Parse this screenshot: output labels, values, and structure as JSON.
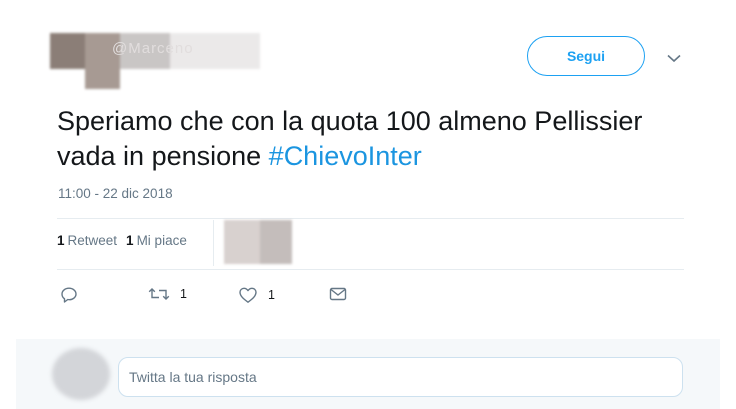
{
  "header": {
    "author_name_blurred": "@Marceno",
    "follow_label": "Segui"
  },
  "tweet": {
    "text_plain": "Speriamo che con la quota 100 almeno Pellissier vada in pensione ",
    "hashtag": "#ChievoInter",
    "timestamp": "11:00 - 22 dic 2018"
  },
  "stats": {
    "retweets_count": "1",
    "retweets_label": "Retweet",
    "likes_count": "1",
    "likes_label": "Mi piace"
  },
  "actions": {
    "reply_icon": "reply-icon",
    "retweet_icon": "retweet-icon",
    "retweet_count": "1",
    "like_icon": "heart-icon",
    "like_count": "1",
    "dm_icon": "envelope-icon"
  },
  "reply": {
    "placeholder": "Twitta la tua risposta"
  },
  "colors": {
    "accent": "#1da1f2",
    "hashtag": "#1b95e0",
    "muted": "#657786",
    "text": "#14171a"
  }
}
